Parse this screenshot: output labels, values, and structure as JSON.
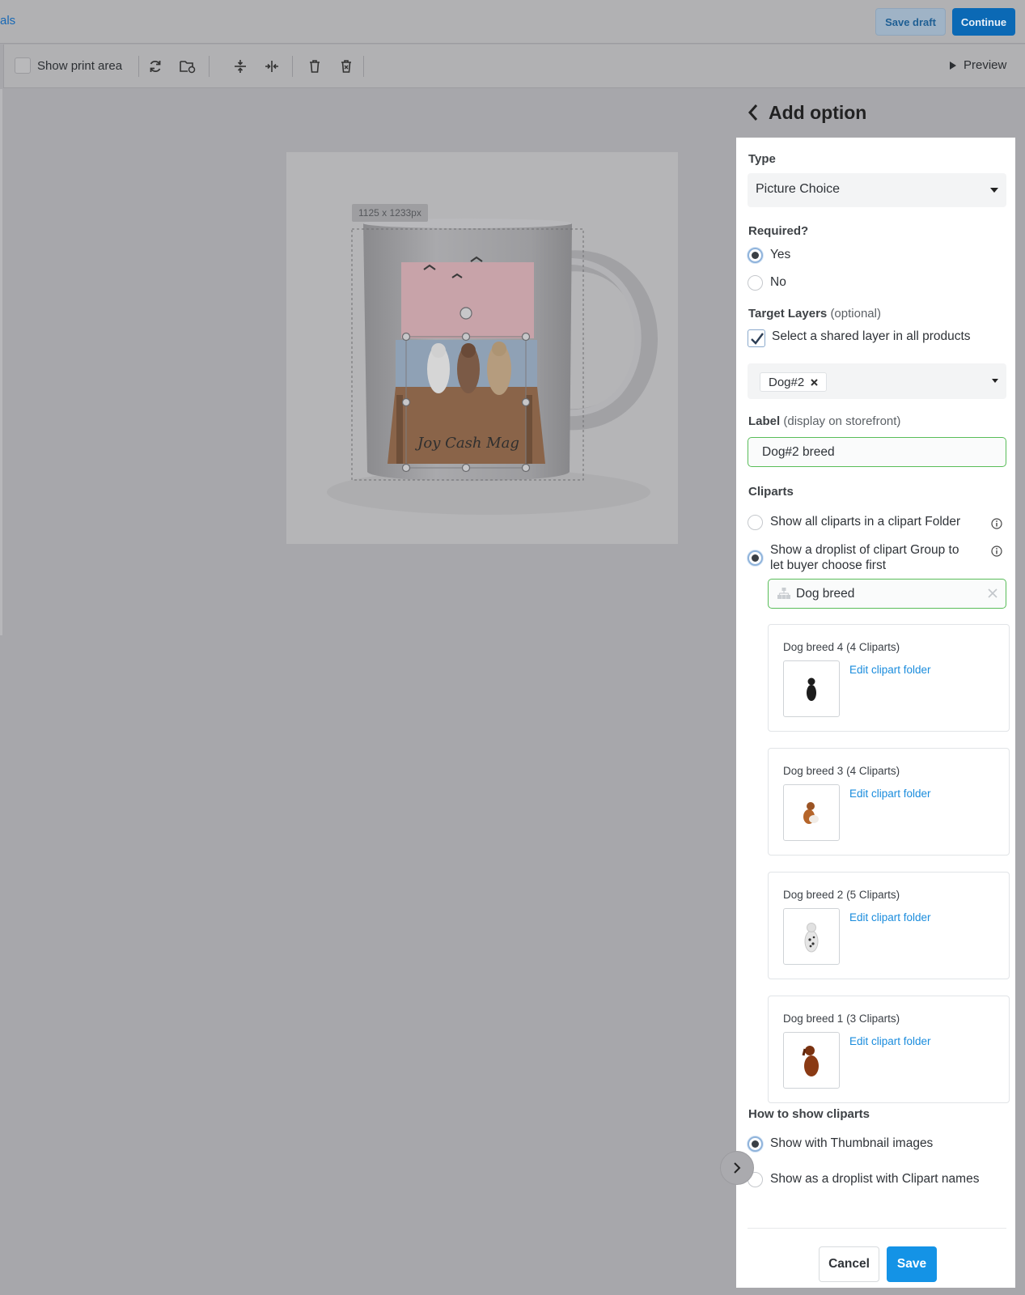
{
  "topbar": {
    "breadcrumb_fragment": "als",
    "save_draft": "Save draft",
    "continue": "Continue"
  },
  "toolbar": {
    "show_print_area": "Show print area",
    "preview": "Preview"
  },
  "canvas": {
    "dimension_badge": "1125 x 1233px"
  },
  "panel": {
    "title": "Add option",
    "type": {
      "label": "Type",
      "value": "Picture Choice"
    },
    "required": {
      "label": "Required?",
      "options": [
        "Yes",
        "No"
      ],
      "selected": "Yes"
    },
    "target_layers": {
      "label": "Target Layers",
      "optional": "(optional)",
      "checkbox_label": "Select a shared layer in all products",
      "checked": true,
      "selected_tag": "Dog#2"
    },
    "label_field": {
      "label": "Label",
      "hint": "(display on storefront)",
      "value": "Dog#2 breed"
    },
    "cliparts": {
      "label": "Cliparts",
      "option_folder": "Show all cliparts in a clipart Folder",
      "option_group": "Show a droplist of clipart Group to let buyer choose first",
      "selected": "group",
      "group_value": "Dog breed",
      "folders": [
        {
          "name": "Dog breed 4",
          "count": "(4 Cliparts)",
          "edit": "Edit clipart folder",
          "color": "#1c1c1c"
        },
        {
          "name": "Dog breed 3",
          "count": "(4 Cliparts)",
          "edit": "Edit clipart folder",
          "color": "#b5652a"
        },
        {
          "name": "Dog breed 2",
          "count": "(5 Cliparts)",
          "edit": "Edit clipart folder",
          "color": "#d9d9d9"
        },
        {
          "name": "Dog breed 1",
          "count": "(3 Cliparts)",
          "edit": "Edit clipart folder",
          "color": "#8a3a14"
        }
      ]
    },
    "how_to_show": {
      "label": "How to show cliparts",
      "options": [
        "Show with Thumbnail images",
        "Show as a droplist with Clipart names"
      ],
      "selected": "Show with Thumbnail images"
    },
    "cancel": "Cancel",
    "save": "Save"
  },
  "colors": {
    "accent": "#1493e6",
    "continue_bg": "#0b69b5",
    "green_border": "#59bd59",
    "link": "#1a8cdd"
  }
}
